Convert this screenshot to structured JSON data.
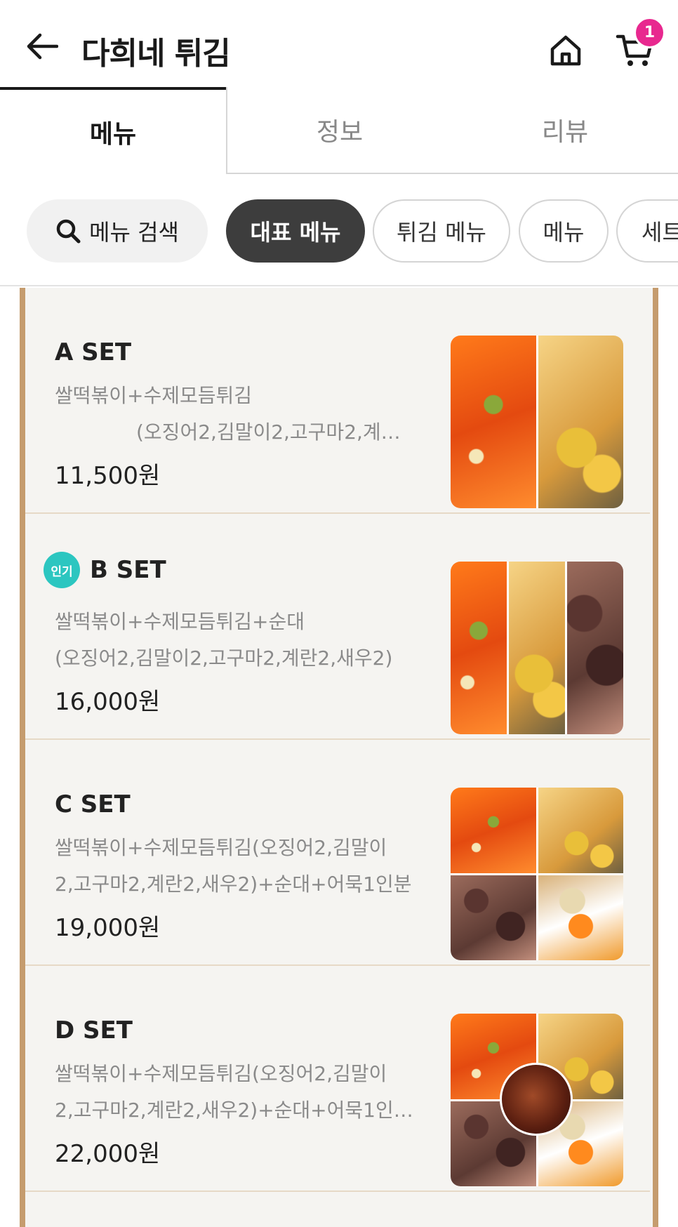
{
  "header": {
    "title": "다희네 튀김",
    "cart_count": "1"
  },
  "tabs": [
    {
      "label": "메뉴",
      "active": true
    },
    {
      "label": "정보",
      "active": false
    },
    {
      "label": "리뷰",
      "active": false
    }
  ],
  "chips": {
    "search_label": "메뉴 검색",
    "items": [
      "대표 메뉴",
      "튀김 메뉴",
      "메뉴",
      "세트"
    ]
  },
  "menu": [
    {
      "name": "A SET",
      "desc_line1": "쌀떡볶이+수제모듬튀김",
      "desc_line2": "(오징어2,김말이2,고구마2,계…",
      "price": "11,500원",
      "popular": false
    },
    {
      "name": "B SET",
      "badge": "인기",
      "desc_line1": "쌀떡볶이+수제모듬튀김+순대",
      "desc_line2": "(오징어2,김말이2,고구마2,계란2,새우2)",
      "price": "16,000원",
      "popular": true
    },
    {
      "name": "C SET",
      "desc_line1": "쌀떡볶이+수제모듬튀김(오징어2,김말이",
      "desc_line2": "2,고구마2,계란2,새우2)+순대+어묵1인분",
      "price": "19,000원",
      "popular": false
    },
    {
      "name": "D SET",
      "desc_line1": "쌀떡볶이+수제모듬튀김(오징어2,김말이",
      "desc_line2": "2,고구마2,계란2,새우2)+순대+어묵1인…",
      "price": "22,000원",
      "popular": false
    }
  ],
  "colors": {
    "accent_badge": "#e8288f",
    "popular_badge": "#2cc6c0",
    "active_chip": "#3d3d3d",
    "frame": "#c59c6e"
  },
  "icons": [
    "back-arrow-icon",
    "home-icon",
    "cart-icon",
    "search-icon"
  ]
}
